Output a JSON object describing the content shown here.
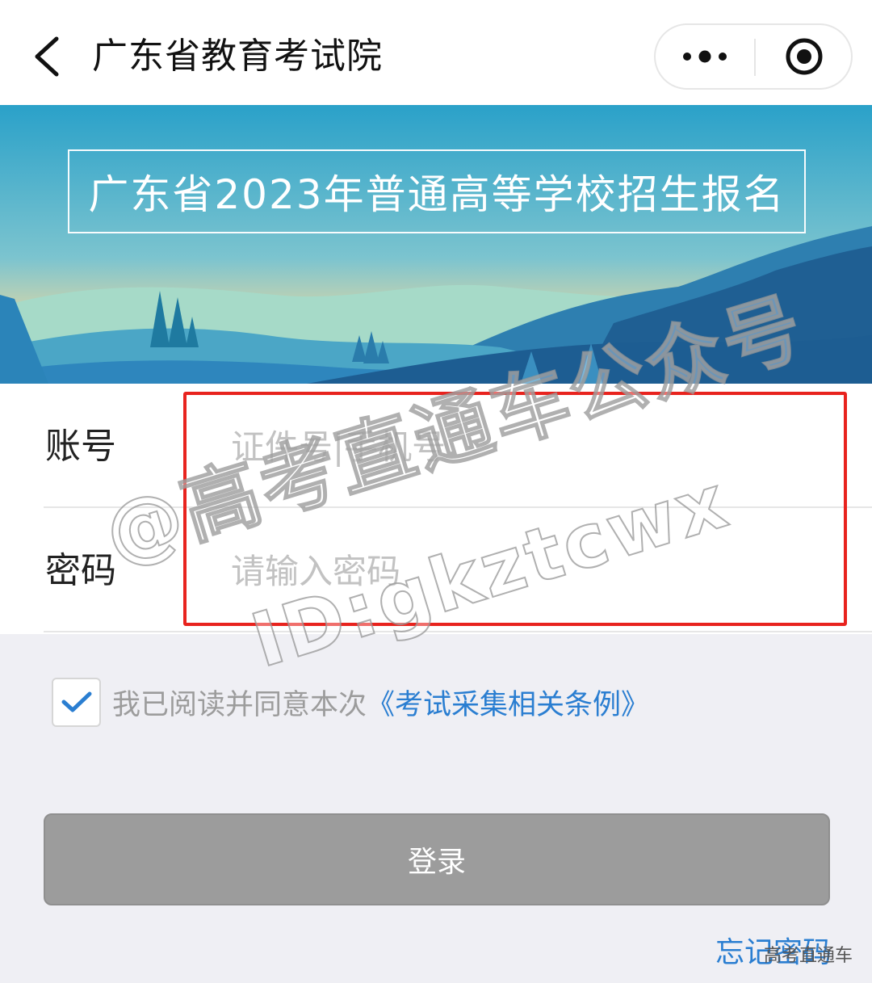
{
  "navbar": {
    "title": "广东省教育考试院",
    "icons": {
      "back": "chevron-left-icon",
      "more": "more-dots-icon",
      "close": "target-circle-icon"
    }
  },
  "banner": {
    "title": "广东省2023年普通高等学校招生报名"
  },
  "form": {
    "account": {
      "label": "账号",
      "placeholder": "证件号|手机号",
      "value": ""
    },
    "password": {
      "label": "密码",
      "placeholder": "请输入密码",
      "value": ""
    }
  },
  "agreement": {
    "checked": true,
    "text": "我已阅读并同意本次",
    "link": "《考试采集相关条例》"
  },
  "login": {
    "label": "登录"
  },
  "forgot_password": {
    "label": "忘记密码"
  },
  "watermark": {
    "line1": "@高考直通车公众号",
    "line2": "ID:gkztcwx",
    "corner": "高考直通车"
  },
  "colors": {
    "accent_link": "#2a7ed1",
    "highlight_border": "#e8231e",
    "login_button": "#9c9c9c",
    "page_background": "#efeff4",
    "banner_sky_top": "#2aa1c9"
  }
}
